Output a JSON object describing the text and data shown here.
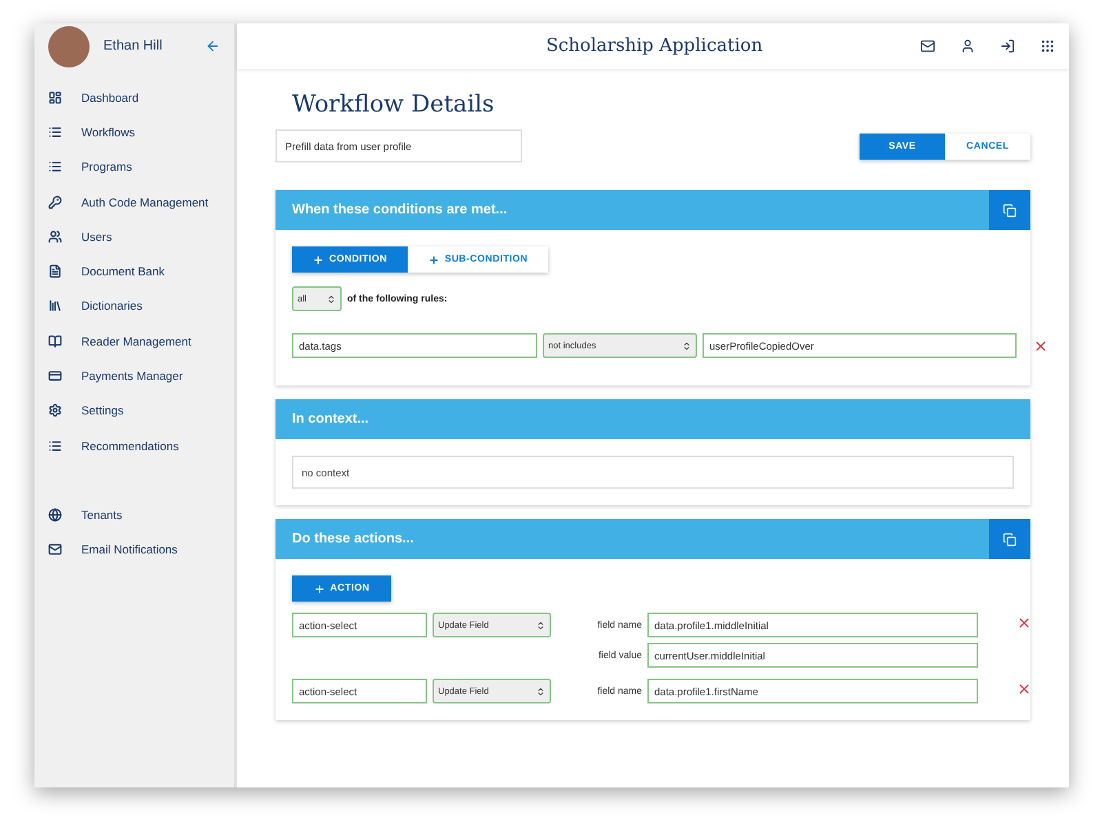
{
  "user": {
    "name": "Ethan Hill"
  },
  "sidebar": {
    "items": [
      {
        "label": "Dashboard"
      },
      {
        "label": "Workflows"
      },
      {
        "label": "Programs"
      },
      {
        "label": "Auth Code Management"
      },
      {
        "label": "Users"
      },
      {
        "label": "Document Bank"
      },
      {
        "label": "Dictionaries"
      },
      {
        "label": "Reader Management"
      },
      {
        "label": "Payments Manager"
      },
      {
        "label": "Settings"
      },
      {
        "label": "Recommendations"
      }
    ],
    "footer_items": [
      {
        "label": "Tenants"
      },
      {
        "label": "Email Notifications"
      }
    ]
  },
  "header": {
    "title": "Scholarship Application"
  },
  "page": {
    "title": "Workflow Details",
    "name_field": {
      "value": "Prefill data from user profile"
    },
    "buttons": [
      {
        "label": "SAVE",
        "kind": "primary"
      },
      {
        "label": "CANCEL",
        "kind": "secondary"
      }
    ]
  },
  "conditions": {
    "title": "When these conditions are met...",
    "tabs": [
      {
        "label": "CONDITION",
        "selected": true
      },
      {
        "label": "SUB-CONDITION",
        "selected": false
      }
    ],
    "match": {
      "value": "all",
      "label": "of the following rules:"
    },
    "rules": [
      {
        "field": "data.tags",
        "operator": "not includes",
        "value": "userProfileCopiedOver"
      }
    ]
  },
  "context": {
    "title": "In context...",
    "value": "no context"
  },
  "actions": {
    "title": "Do these actions...",
    "add_button": "ACTION",
    "rows": [
      {
        "name": "action-select",
        "type": "Update Field",
        "fields": [
          {
            "label": "field name",
            "value": "data.profile1.middleInitial"
          },
          {
            "label": "field value",
            "value": "currentUser.middleInitial"
          }
        ]
      },
      {
        "name": "action-select",
        "type": "Update Field",
        "fields": [
          {
            "label": "field name",
            "value": "data.profile1.firstName"
          }
        ]
      }
    ]
  }
}
